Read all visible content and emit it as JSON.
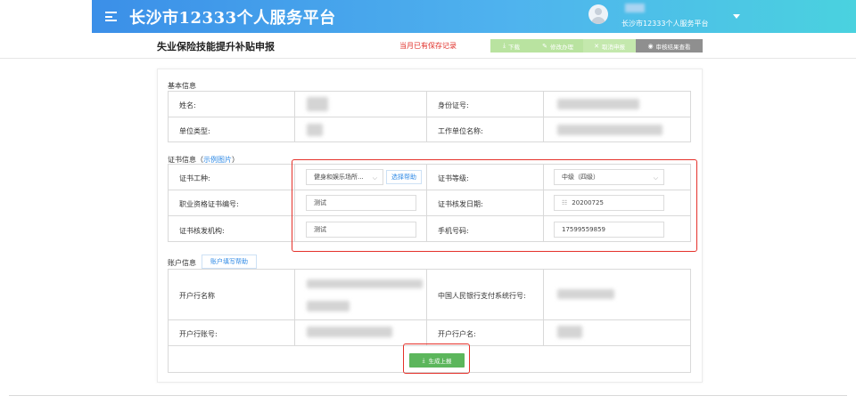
{
  "header": {
    "brand": "长沙市12333个人服务平台",
    "user_label": "长沙市12333个人服务平台"
  },
  "subheader": {
    "title": "失业保险技能提升补贴申报",
    "status_note": "当月已有保存记录",
    "buttons": {
      "download": "下载",
      "edit": "修改办理",
      "cancel": "取消申报",
      "view": "审核结果查看"
    }
  },
  "basic_info": {
    "section_title": "基本信息",
    "name_label": "姓名:",
    "id_label": "身份证号:",
    "unit_type_label": "单位类型:",
    "employer_label": "工作单位名称:"
  },
  "cert_info": {
    "section_title": "证书信息",
    "example_link": "示例图片",
    "paren_open": "（",
    "paren_close": "）",
    "type_label": "证书工种:",
    "type_value": "健身和娱乐场所...",
    "choose_help": "选择帮助",
    "level_label": "证书等级:",
    "level_value": "中级（四级）",
    "cert_no_label": "职业资格证书编号:",
    "cert_no_value": "测试",
    "issue_date_label": "证书核发日期:",
    "issue_date_value": "20200725",
    "issuer_label": "证书核发机构:",
    "issuer_value": "测试",
    "phone_label": "手机号码:",
    "phone_value": "17599559859"
  },
  "account_info": {
    "section_title": "账户信息",
    "fill_help": "账户填写帮助",
    "bank_name_label": "开户行名称",
    "pboc_label": "中国人民银行支付系统行号:",
    "account_no_label": "开户行账号:",
    "account_holder_label": "开户行户名:"
  },
  "submit": {
    "label": "生成上报"
  },
  "icons": {
    "menu": "hamburger-icon",
    "download": "download-icon",
    "edit": "edit-icon",
    "cancel": "close-icon",
    "view": "eye-icon",
    "calendar": "calendar-icon",
    "dropdown": "chevron-down-icon"
  },
  "colors": {
    "header_start": "#3b8fe8",
    "header_end": "#4ad2df",
    "alert_red": "#e5312a",
    "submit_green": "#5cb65c",
    "link_blue": "#2f8ae6"
  }
}
